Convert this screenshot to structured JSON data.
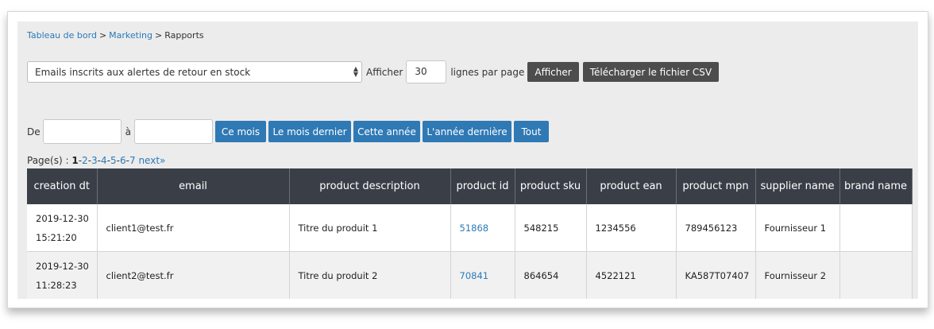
{
  "breadcrumb": {
    "items": [
      "Tableau de bord",
      "Marketing"
    ],
    "current": "Rapports",
    "separator": ">"
  },
  "report_select": {
    "selected": "Emails inscrits aux alertes de retour en stock",
    "arrows_up": "▲",
    "arrows_down": "▼"
  },
  "display": {
    "afficher_label": "Afficher",
    "rows_value": "30",
    "rows_suffix": "lignes par page",
    "afficher_button": "Afficher",
    "csv_button": "Télécharger le fichier CSV"
  },
  "date_filter": {
    "from_label": "De",
    "to_label": "à",
    "from_value": "",
    "to_value": "",
    "presets": [
      "Ce mois",
      "Le mois dernier",
      "Cette année",
      "L'année dernière",
      "Tout"
    ]
  },
  "pagination": {
    "prefix": "Page(s) : ",
    "current": "1",
    "pages": [
      "2",
      "3",
      "4",
      "5",
      "6",
      "7"
    ],
    "separator": "-",
    "next": "next»"
  },
  "table": {
    "columns": [
      "creation dt",
      "email",
      "product description",
      "product id",
      "product sku",
      "product ean",
      "product mpn",
      "supplier name",
      "brand name"
    ],
    "rows": [
      {
        "date": "2019-12-30",
        "time": "15:21:20",
        "email": "client1@test.fr",
        "description": "Titre du produit 1",
        "product_id": "51868",
        "sku": "548215",
        "ean": "1234556",
        "mpn": "789456123",
        "supplier": "Fournisseur 1",
        "brand": ""
      },
      {
        "date": "2019-12-30",
        "time": "11:28:23",
        "email": "client2@test.fr",
        "description": "Titre du produit 2",
        "product_id": "70841",
        "sku": "864654",
        "ean": "4522121",
        "mpn": "KA587T07407",
        "supplier": "Fournisseur 2",
        "brand": ""
      }
    ]
  },
  "colors": {
    "link": "#2a7ab7",
    "header_bg": "#3a3f47",
    "button_blue": "#2f79b5",
    "button_dark": "#4d4d4d",
    "panel_bg": "#ececec"
  }
}
